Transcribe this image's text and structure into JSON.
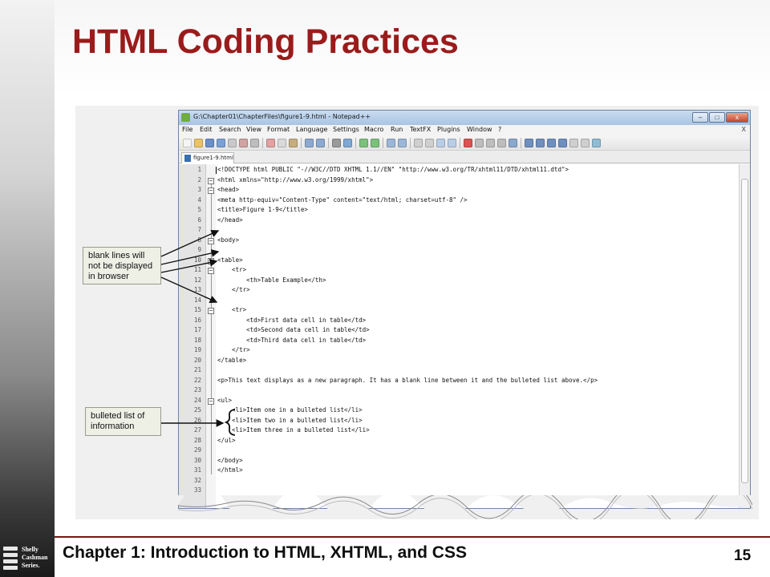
{
  "slide": {
    "title": "HTML Coding Practices",
    "footer": "Chapter 1: Introduction to HTML, XHTML, and CSS",
    "page_number": "15",
    "logo_lines": [
      "Shelly",
      "Cashman",
      "Series."
    ],
    "title_color": "#9a1b1b"
  },
  "window": {
    "title": "G:\\Chapter01\\ChapterFiles\\figure1-9.html - Notepad++",
    "buttons": {
      "minimize": "–",
      "maximize": "□",
      "close": "x"
    },
    "menu": [
      "File",
      "Edit",
      "Search",
      "View",
      "Format",
      "Language",
      "Settings",
      "Macro",
      "Run",
      "TextFX",
      "Plugins",
      "Window",
      "?"
    ],
    "menu_close": "X",
    "tab_label": "figure1-9.html"
  },
  "editor": {
    "lines": [
      "<!DOCTYPE html PUBLIC \"-//W3C//DTD XHTML 1.1//EN\" \"http://www.w3.org/TR/xhtml11/DTD/xhtml11.dtd\">",
      "<html xmlns=\"http://www.w3.org/1999/xhtml\">",
      "<head>",
      "<meta http-equiv=\"Content-Type\" content=\"text/html; charset=utf-8\" />",
      "<title>Figure 1-9</title>",
      "</head>",
      "",
      "<body>",
      "",
      "<table>",
      "    <tr>",
      "        <th>Table Example</th>",
      "    </tr>",
      "",
      "    <tr>",
      "        <td>First data cell in table</td>",
      "        <td>Second data cell in table</td>",
      "        <td>Third data cell in table</td>",
      "    </tr>",
      "</table>",
      "",
      "<p>This text displays as a new paragraph. It has a blank line between it and the bulleted list above.</p>",
      "",
      "<ul>",
      "    <li>Item one in a bulleted list</li>",
      "    <li>Item two in a bulleted list</li>",
      "    <li>Item three in a bulleted list</li>",
      "</ul>",
      "",
      "</body>",
      "</html>",
      "",
      ""
    ],
    "line_numbers": [
      "1",
      "2",
      "3",
      "4",
      "5",
      "6",
      "7",
      "8",
      "9",
      "10",
      "11",
      "12",
      "13",
      "14",
      "15",
      "16",
      "17",
      "18",
      "19",
      "20",
      "21",
      "22",
      "23",
      "24",
      "25",
      "26",
      "27",
      "28",
      "29",
      "30",
      "31",
      "32",
      "33"
    ]
  },
  "callouts": {
    "blank_lines": [
      "blank lines will",
      "not be displayed",
      "in browser"
    ],
    "bulleted_list": [
      "bulleted list of",
      "information"
    ]
  }
}
